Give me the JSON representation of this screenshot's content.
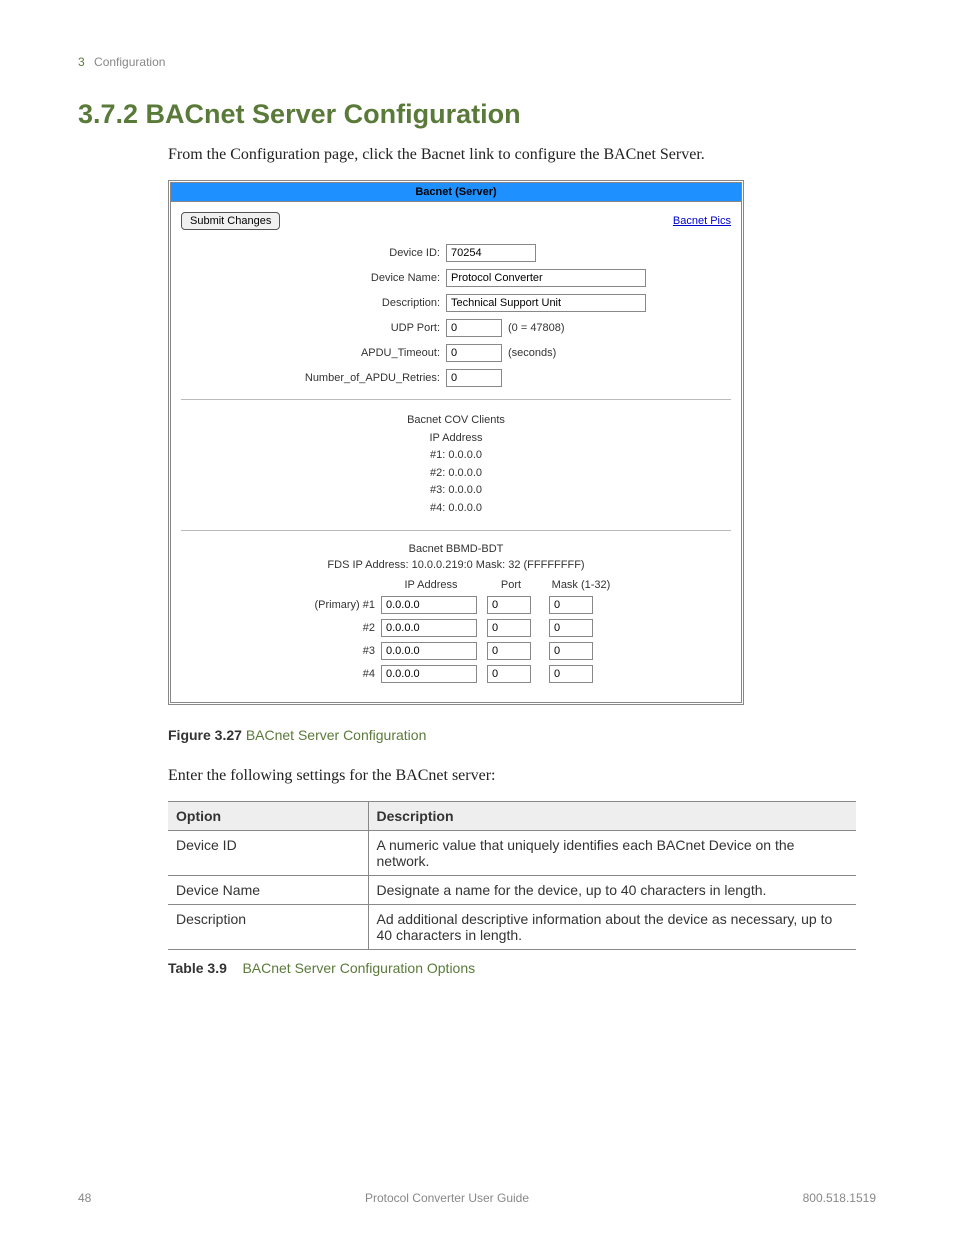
{
  "header": {
    "chapter_num": "3",
    "chapter_title": "Configuration"
  },
  "section": {
    "title": "3.7.2 BACnet Server Configuration",
    "intro": "From the Configuration page, click the Bacnet link to configure the BACnet Server."
  },
  "panel": {
    "title": "Bacnet (Server)",
    "submit": "Submit Changes",
    "link": "Bacnet Pics",
    "fields": {
      "device_id": {
        "label": "Device ID:",
        "value": "70254"
      },
      "device_name": {
        "label": "Device Name:",
        "value": "Protocol Converter"
      },
      "description": {
        "label": "Description:",
        "value": "Technical Support Unit"
      },
      "udp_port": {
        "label": "UDP Port:",
        "value": "0",
        "suffix": "(0 = 47808)"
      },
      "apdu_timeout": {
        "label": "APDU_Timeout:",
        "value": "0",
        "suffix": "(seconds)"
      },
      "apdu_retries": {
        "label": "Number_of_APDU_Retries:",
        "value": "0"
      }
    },
    "cov": {
      "title": "Bacnet COV Clients",
      "subtitle": "IP Address",
      "rows": [
        "#1: 0.0.0.0",
        "#2: 0.0.0.0",
        "#3: 0.0.0.0",
        "#4: 0.0.0.0"
      ]
    },
    "bbmd": {
      "title": "Bacnet BBMD-BDT",
      "fds": "FDS IP Address: 10.0.0.219:0 Mask: 32 (FFFFFFFF)",
      "headers": {
        "ip": "IP Address",
        "port": "Port",
        "mask": "Mask (1-32)"
      },
      "rows": [
        {
          "label": "(Primary) #1",
          "ip": "0.0.0.0",
          "port": "0",
          "mask": "0"
        },
        {
          "label": "#2",
          "ip": "0.0.0.0",
          "port": "0",
          "mask": "0"
        },
        {
          "label": "#3",
          "ip": "0.0.0.0",
          "port": "0",
          "mask": "0"
        },
        {
          "label": "#4",
          "ip": "0.0.0.0",
          "port": "0",
          "mask": "0"
        }
      ]
    }
  },
  "figure": {
    "bold": "Figure 3.27",
    "text": " BACnet Server Configuration"
  },
  "lead2": "Enter the following settings for the BACnet server:",
  "options_table": {
    "headers": {
      "option": "Option",
      "description": "Description"
    },
    "rows": [
      {
        "option": "Device ID",
        "description": "A numeric value that uniquely identifies each BACnet Device on the network."
      },
      {
        "option": "Device Name",
        "description": "Designate a name for the device, up to 40 characters in length."
      },
      {
        "option": "Description",
        "description": "Ad additional descriptive information about the device as necessary, up to 40 characters in length."
      }
    ]
  },
  "table_caption": {
    "bold": "Table 3.9",
    "text": "BACnet Server Configuration Options"
  },
  "footer": {
    "page": "48",
    "center": "Protocol Converter User Guide",
    "right": "800.518.1519"
  }
}
